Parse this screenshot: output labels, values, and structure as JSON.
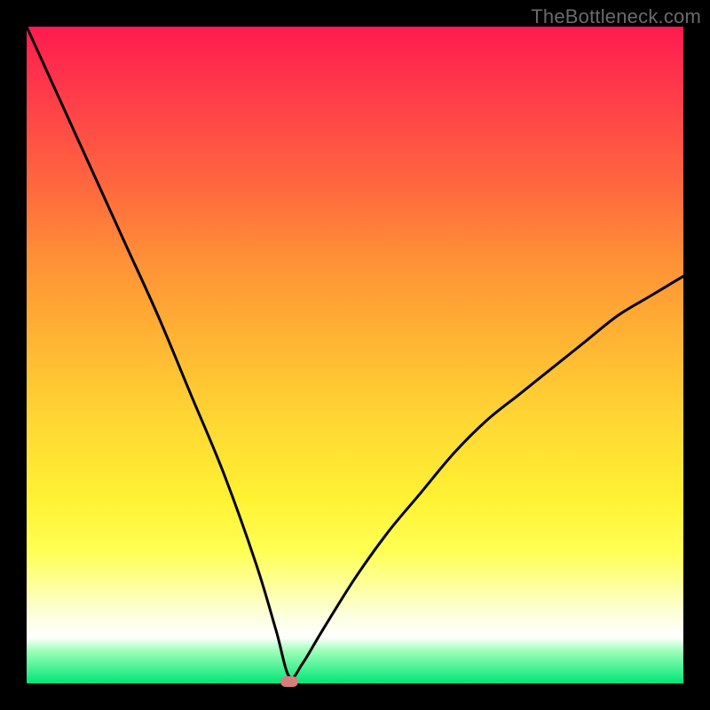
{
  "attribution": "TheBottleneck.com",
  "colors": {
    "gradient_top": "#ff1a4f",
    "gradient_mid": "#fff233",
    "gradient_bottom": "#00e676",
    "curve": "#000000",
    "marker": "#d87d7d",
    "frame": "#000000"
  },
  "chart_data": {
    "type": "line",
    "title": "",
    "xlabel": "",
    "ylabel": "",
    "xlim": [
      0,
      100
    ],
    "ylim": [
      0,
      100
    ],
    "grid": false,
    "legend": false,
    "description": "Absolute-value-like V curve; vertex near x≈40 touches y≈0; left branch reaches y≈100 at x≈0; right branch reaches y≈62 at x≈100.",
    "series": [
      {
        "name": "bottleneck-curve",
        "x": [
          0,
          5,
          10,
          15,
          20,
          25,
          30,
          35,
          38,
          40,
          42,
          45,
          50,
          55,
          60,
          65,
          70,
          75,
          80,
          85,
          90,
          95,
          100
        ],
        "y": [
          100,
          89,
          78,
          67,
          56,
          44,
          32,
          18,
          8,
          1,
          3,
          8,
          16,
          23,
          29,
          35,
          40,
          44,
          48,
          52,
          56,
          59,
          62
        ]
      }
    ],
    "marker": {
      "x": 40,
      "y": 0
    }
  }
}
